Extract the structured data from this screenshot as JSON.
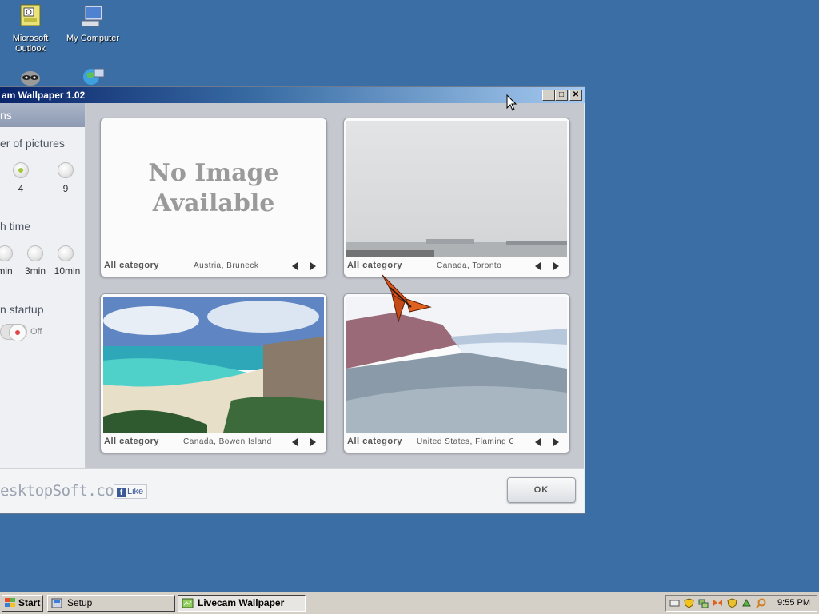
{
  "desktop": {
    "icons": [
      {
        "label": "Microsoft Outlook"
      },
      {
        "label": "My Computer"
      }
    ]
  },
  "window": {
    "title": "am Wallpaper 1.02",
    "sidebar": {
      "header": "ns",
      "pictures_label": "er of pictures",
      "pictures_options": [
        "4",
        "9"
      ],
      "pictures_selected": "4",
      "time_label": "h time",
      "time_options": [
        "min",
        "3min",
        "10min"
      ],
      "startup_label": "n startup",
      "startup_state": "Off"
    },
    "tiles": [
      {
        "category": "All category",
        "location": "Austria, Bruneck",
        "no_image_line1": "No Image",
        "no_image_line2": "Available"
      },
      {
        "category": "All category",
        "location": "Canada, Toronto"
      },
      {
        "category": "All category",
        "location": "Canada, Bowen Island"
      },
      {
        "category": "All category",
        "location": "United States, Flaming Gorg"
      }
    ],
    "brand": "esktopSoft.com",
    "like_label": "Like",
    "ok_label": "OK"
  },
  "taskbar": {
    "start_label": "Start",
    "tasks": [
      "Setup",
      "Livecam Wallpaper"
    ],
    "active_task": "Livecam Wallpaper",
    "clock": "9:55 PM"
  },
  "colors": {
    "desktop_bg": "#3a6ea5",
    "title_gradient_start": "#0a246a",
    "accent_green": "#a2c93a"
  }
}
